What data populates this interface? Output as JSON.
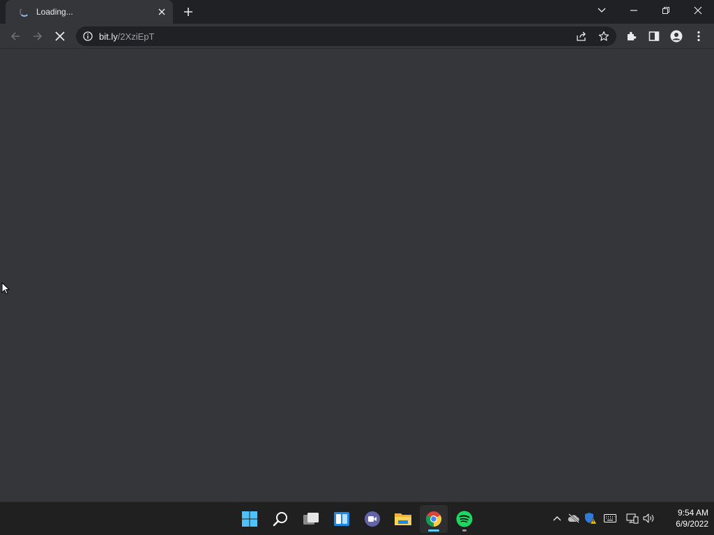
{
  "browser": {
    "tab": {
      "title": "Loading...",
      "loading_icon": "loading-spinner-icon",
      "close_icon": "close-icon"
    },
    "new_tab_icon": "plus-icon",
    "window_controls": [
      "chevron-down-icon",
      "minimize-icon",
      "restore-icon",
      "close-icon"
    ],
    "toolbar": {
      "back_icon": "arrow-left-icon",
      "forward_icon": "arrow-right-icon",
      "stop_icon": "stop-icon",
      "site_info_icon": "info-icon",
      "url_host": "bit.ly",
      "url_path": "/2XziEpT",
      "share_icon": "share-icon",
      "bookmark_icon": "star-icon",
      "extensions_icon": "puzzle-icon",
      "side_panel_icon": "side-panel-icon",
      "profile_icon": "person-icon",
      "menu_icon": "kebab-menu-icon"
    },
    "accent_color": "#8ab4f8"
  },
  "taskbar": {
    "apps": [
      {
        "name": "start",
        "icon": "windows-logo-icon"
      },
      {
        "name": "search",
        "icon": "search-icon"
      },
      {
        "name": "task-view",
        "icon": "task-view-icon"
      },
      {
        "name": "widgets",
        "icon": "widgets-icon"
      },
      {
        "name": "teams-chat",
        "icon": "video-chat-icon"
      },
      {
        "name": "file-explorer",
        "icon": "folder-icon"
      },
      {
        "name": "chrome",
        "icon": "chrome-icon",
        "active": true
      },
      {
        "name": "spotify",
        "icon": "spotify-icon",
        "running": true
      }
    ],
    "tray_icons": [
      "chevron-up-icon",
      "cloud-offline-icon",
      "security-warning-icon",
      "keyboard-icon",
      "network-icon",
      "volume-icon"
    ],
    "clock": {
      "time": "9:54 AM",
      "date": "6/9/2022"
    }
  }
}
